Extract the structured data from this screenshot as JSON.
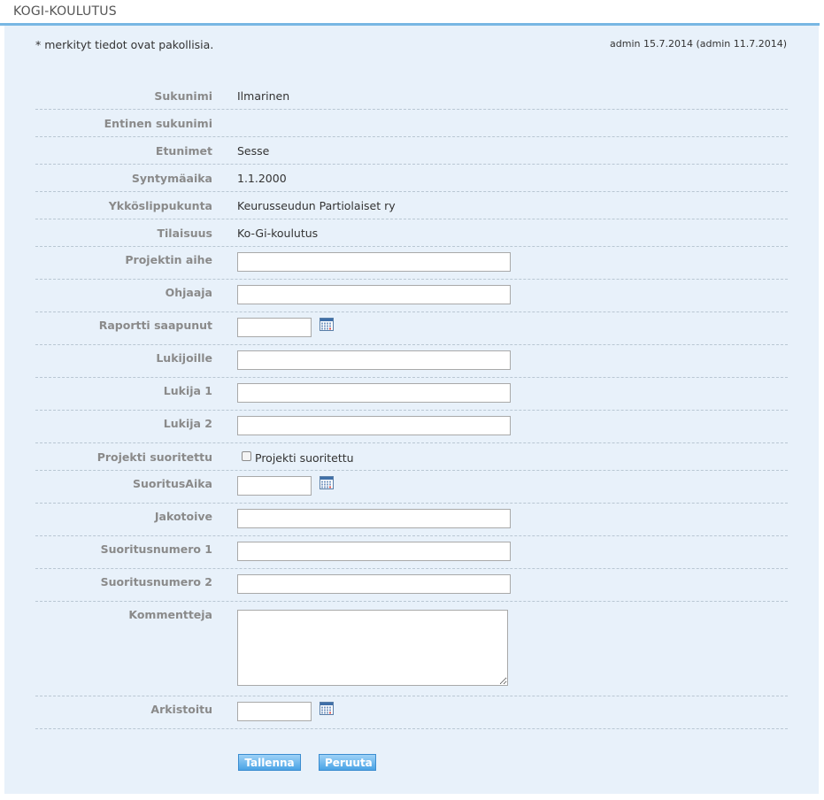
{
  "page": {
    "title": "KOGI-KOULUTUS",
    "required_note": "* merkityt tiedot ovat pakollisia.",
    "modified_info": "admin 15.7.2014 (admin 11.7.2014)"
  },
  "form": {
    "sukunimi": {
      "label": "Sukunimi",
      "value": "Ilmarinen"
    },
    "entinen_sukunimi": {
      "label": "Entinen sukunimi",
      "value": ""
    },
    "etunimet": {
      "label": "Etunimet",
      "value": "Sesse"
    },
    "syntymaaika": {
      "label": "Syntymäaika",
      "value": "1.1.2000"
    },
    "ykkoslippukunta": {
      "label": "Ykköslippukunta",
      "value": "Keurusseudun Partiolaiset ry"
    },
    "tilaisuus": {
      "label": "Tilaisuus",
      "value": "Ko-Gi-koulutus"
    },
    "projektin_aihe": {
      "label": "Projektin aihe",
      "value": ""
    },
    "ohjaaja": {
      "label": "Ohjaaja",
      "value": ""
    },
    "raportti_saapunut": {
      "label": "Raportti saapunut",
      "value": ""
    },
    "lukijoille": {
      "label": "Lukijoille",
      "value": ""
    },
    "lukija_1": {
      "label": "Lukija 1",
      "value": ""
    },
    "lukija_2": {
      "label": "Lukija 2",
      "value": ""
    },
    "projekti_suoritettu": {
      "label": "Projekti suoritettu",
      "checkbox_label": "Projekti suoritettu",
      "checked": false
    },
    "suoritusaika": {
      "label": "SuoritusAika",
      "value": ""
    },
    "jakotoive": {
      "label": "Jakotoive",
      "value": ""
    },
    "suoritusnumero_1": {
      "label": "Suoritusnumero 1",
      "value": ""
    },
    "suoritusnumero_2": {
      "label": "Suoritusnumero 2",
      "value": ""
    },
    "kommentteja": {
      "label": "Kommentteja",
      "value": ""
    },
    "arkistoitu": {
      "label": "Arkistoitu",
      "value": ""
    }
  },
  "buttons": {
    "save_label": "Tallenna",
    "cancel_label": "Peruuta"
  },
  "icons": {
    "calendar": "calendar-icon"
  },
  "colors": {
    "accent": "#78b7e3",
    "panel_bg": "#e8f1fa",
    "button": "#4aa3e6",
    "label": "#8a8a8a"
  }
}
